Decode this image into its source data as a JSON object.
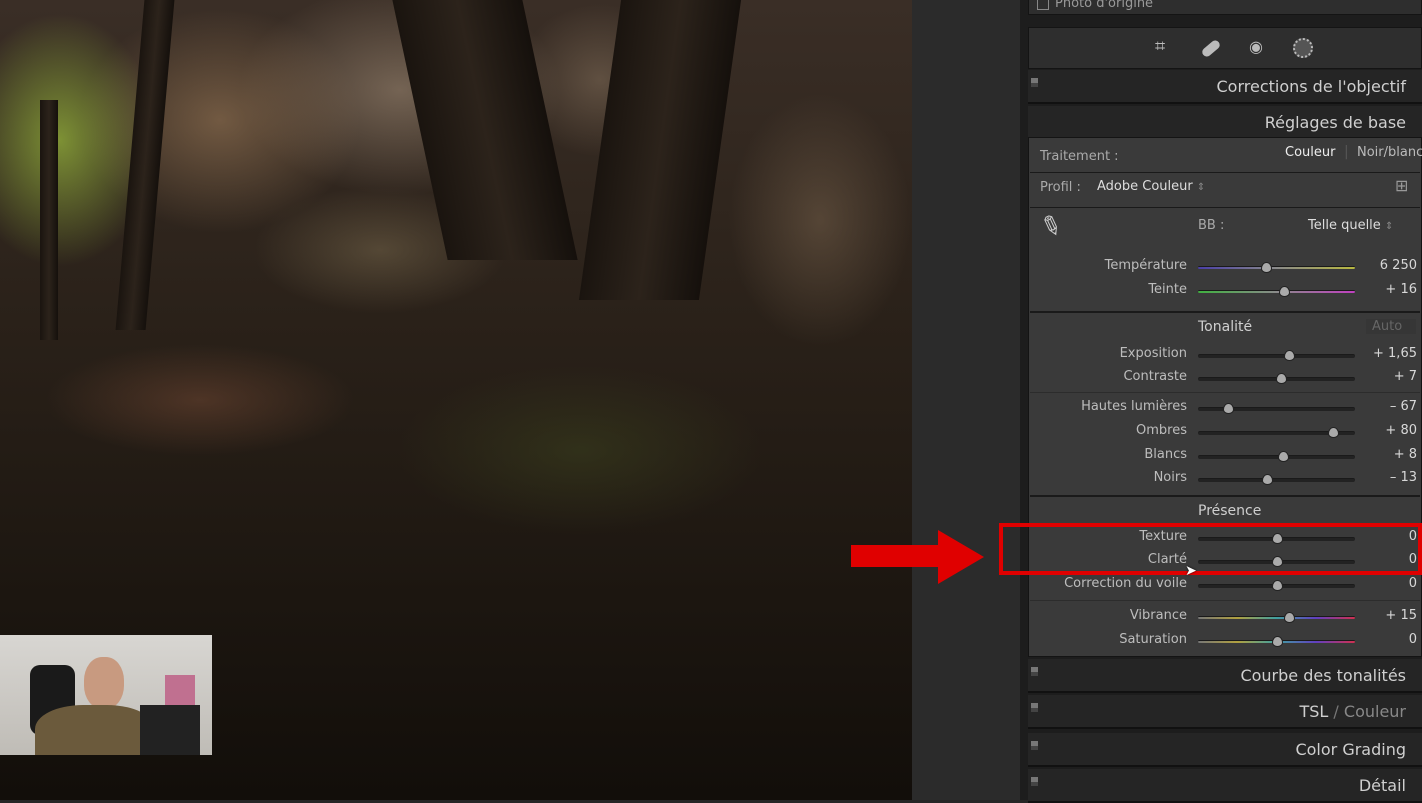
{
  "top": {
    "original_photo_label": "Photo d'origine"
  },
  "tools": [
    "crop-icon",
    "healing-icon",
    "red-eye-icon",
    "masking-icon"
  ],
  "panels": {
    "lens": "Corrections de l'objectif",
    "basic": "Réglages de base",
    "curve": "Courbe des tonalités",
    "hsl_a": "TSL",
    "hsl_sep": " / ",
    "hsl_b": "Couleur",
    "grading": "Color Grading",
    "detail": "Détail"
  },
  "basic": {
    "treatment_label": "Traitement :",
    "treatment_color": "Couleur",
    "treatment_bw": "Noir/blanc",
    "profile_label": "Profil :",
    "profile_value": "Adobe Couleur",
    "wb_label": "BB :",
    "wb_value": "Telle quelle",
    "tone_title": "Tonalité",
    "auto": "Auto",
    "presence_title": "Présence",
    "sliders": [
      {
        "label": "Température",
        "value": "6 250",
        "level": 0.43,
        "gradient": "temp"
      },
      {
        "label": "Teinte",
        "value": "+ 16",
        "level": 0.55,
        "gradient": "tint"
      },
      {
        "label": "Exposition",
        "value": "+ 1,65",
        "level": 0.58
      },
      {
        "label": "Contraste",
        "value": "+ 7",
        "level": 0.53
      },
      {
        "label": "Hautes lumières",
        "value": "– 67",
        "level": 0.19
      },
      {
        "label": "Ombres",
        "value": "+ 80",
        "level": 0.86
      },
      {
        "label": "Blancs",
        "value": "+ 8",
        "level": 0.54
      },
      {
        "label": "Noirs",
        "value": "– 13",
        "level": 0.44
      },
      {
        "label": "Texture",
        "value": "0",
        "level": 0.5
      },
      {
        "label": "Clarté",
        "value": "0",
        "level": 0.5
      },
      {
        "label": "Correction du voile",
        "value": "0",
        "level": 0.5
      },
      {
        "label": "Vibrance",
        "value": "+ 15",
        "level": 0.58,
        "gradient": "sat"
      },
      {
        "label": "Saturation",
        "value": "0",
        "level": 0.5,
        "gradient": "sat"
      }
    ]
  },
  "highlight_color": "#e00000"
}
